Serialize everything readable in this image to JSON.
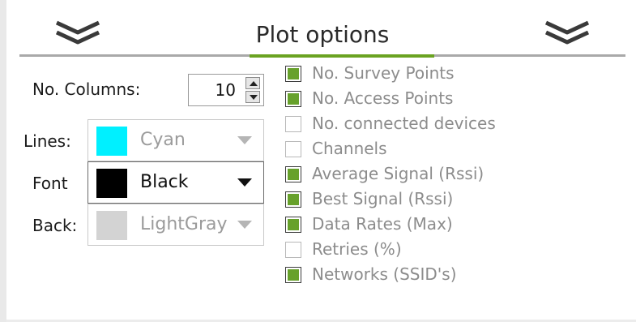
{
  "panel": {
    "title": "Plot options",
    "accent_color": "#6aa321",
    "left_collapse_icon": "double-chevron-down-icon",
    "right_collapse_icon": "double-chevron-down-icon"
  },
  "settings": {
    "columns_label": "No. Columns:",
    "columns_value": "10",
    "lines_label": "Lines:",
    "lines_color_name": "Cyan",
    "lines_color_hex": "#00f0ff",
    "font_label": "Font",
    "font_color_name": "Black",
    "font_color_hex": "#000000",
    "back_label": "Back:",
    "back_color_name": "LightGray",
    "back_color_hex": "#d3d3d3"
  },
  "series": [
    {
      "label": "No. Survey Points",
      "checked": true
    },
    {
      "label": "No. Access Points",
      "checked": true
    },
    {
      "label": "No. connected devices",
      "checked": false
    },
    {
      "label": "Channels",
      "checked": false
    },
    {
      "label": "Average Signal (Rssi)",
      "checked": true
    },
    {
      "label": "Best Signal (Rssi)",
      "checked": true
    },
    {
      "label": "Data Rates (Max)",
      "checked": true
    },
    {
      "label": "Retries (%)",
      "checked": false
    },
    {
      "label": "Networks (SSID's)",
      "checked": true
    }
  ]
}
